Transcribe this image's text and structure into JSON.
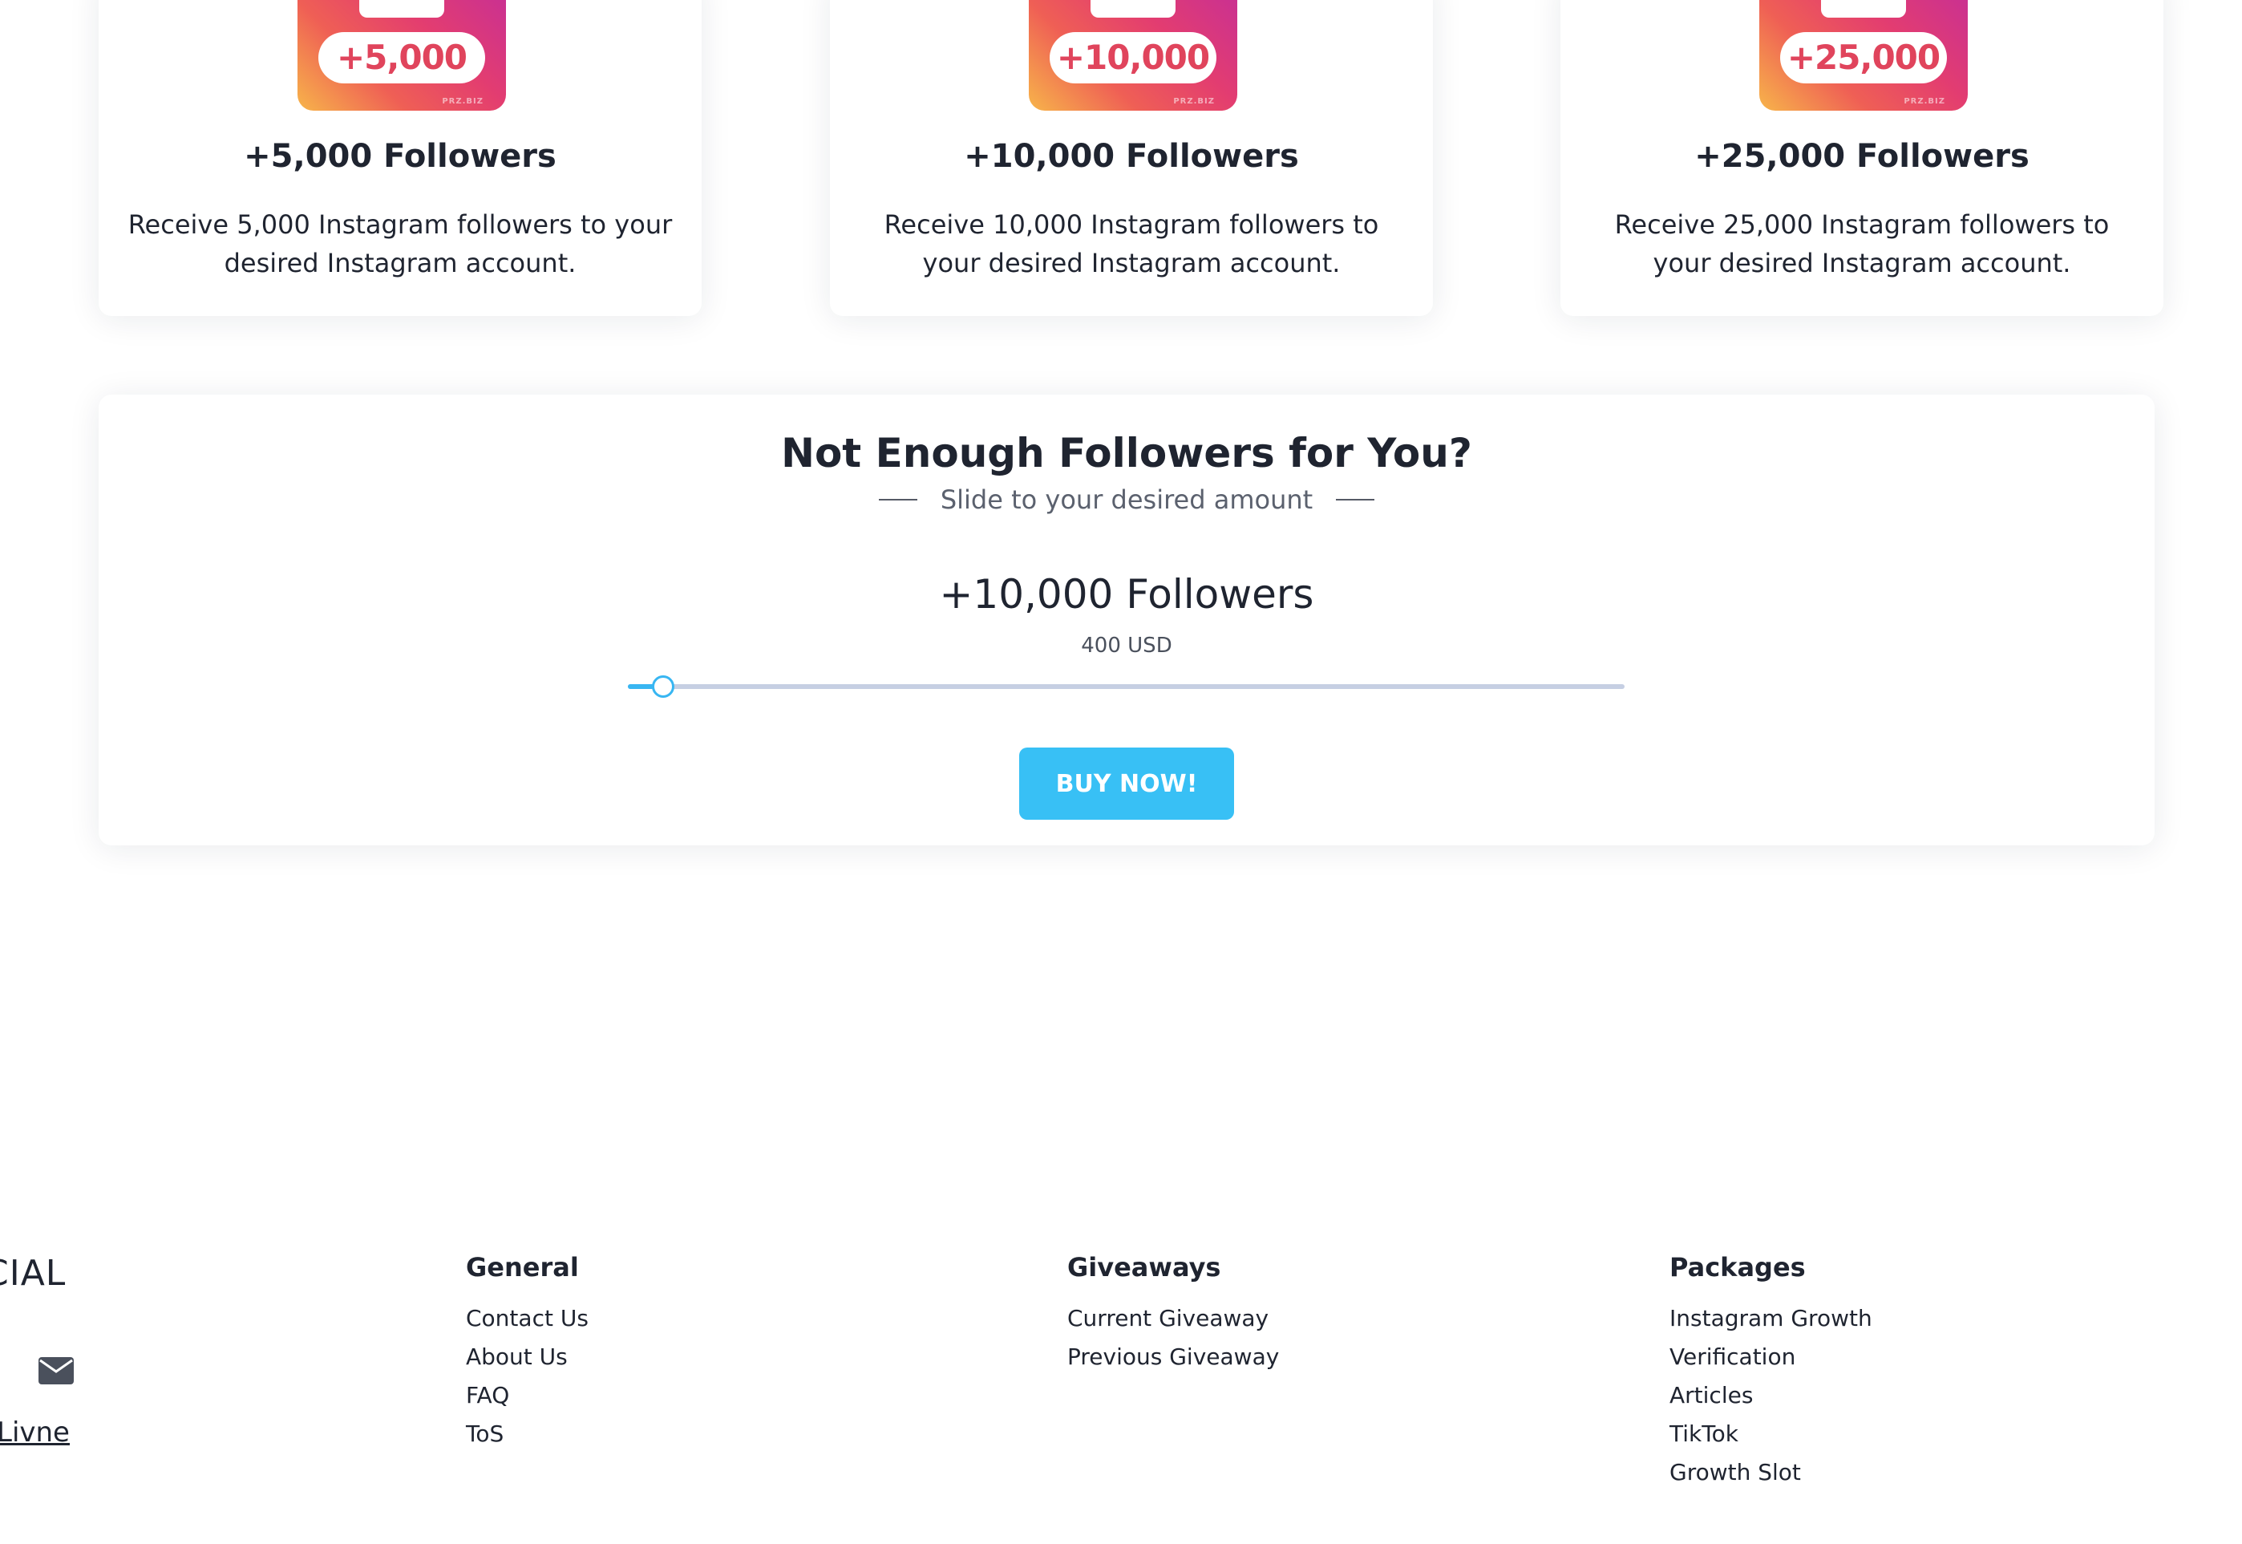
{
  "packages": [
    {
      "badge": "+5,000",
      "watermark": "PRZ.BIZ",
      "title": "+5,000 Followers",
      "description": "Receive 5,000 Instagram followers to your desired Instagram account."
    },
    {
      "badge": "+10,000",
      "watermark": "PRZ.BIZ",
      "title": "+10,000 Followers",
      "description": "Receive 10,000 Instagram followers to your desired Instagram account."
    },
    {
      "badge": "+25,000",
      "watermark": "PRZ.BIZ",
      "title": "+25,000 Followers",
      "description": "Receive 25,000 Instagram followers to your desired Instagram account."
    }
  ],
  "slider": {
    "title": "Not Enough Followers for You?",
    "subtitle": "Slide to your desired amount",
    "amount_label": "+10,000 Followers",
    "price_label": "400 USD",
    "position_fraction": 0.035,
    "button_label": "BUY NOW!",
    "accent_color": "#38c0f5",
    "track_color": "#c6cfe3"
  },
  "footer": {
    "brand_fragment": "CIAL",
    "mail_icon": "envelope-icon",
    "link_fragment": "Livne",
    "columns": [
      {
        "heading": "General",
        "links": [
          "Contact Us",
          "About Us",
          "FAQ",
          "ToS"
        ]
      },
      {
        "heading": "Giveaways",
        "links": [
          "Current Giveaway",
          "Previous Giveaway"
        ]
      },
      {
        "heading": "Packages",
        "links": [
          "Instagram Growth",
          "Verification",
          "Articles",
          "TikTok",
          "Growth Slot"
        ]
      }
    ]
  },
  "colors": {
    "text": "#1f2430",
    "badge_gradient": [
      "#f7b54a",
      "#ef5f55",
      "#e33d70",
      "#c52e98"
    ],
    "badge_text": "#e0445c"
  }
}
